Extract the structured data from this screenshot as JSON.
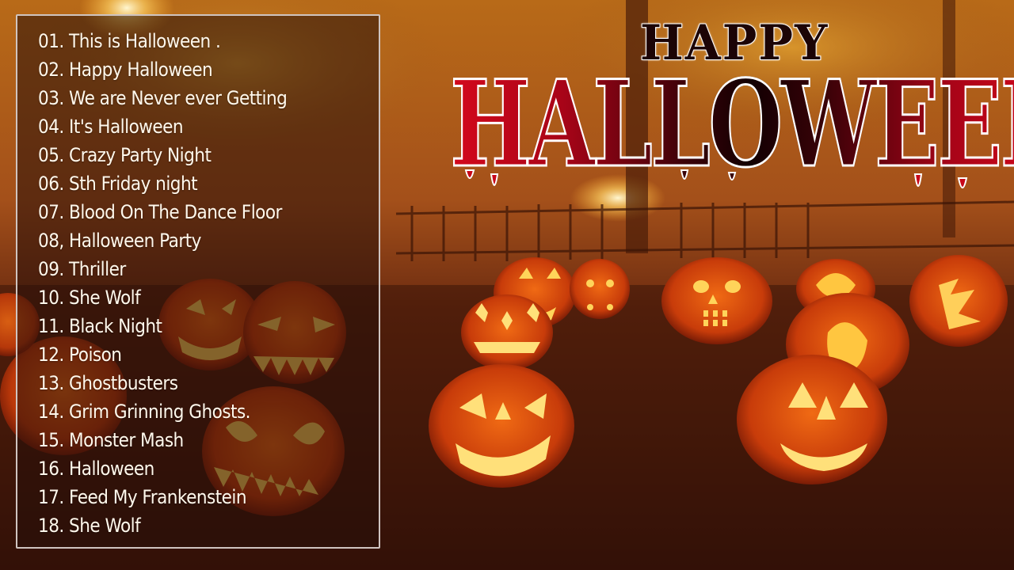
{
  "title": {
    "line1": "HAPPY",
    "line2": "HALLOWEEN"
  },
  "playlist": {
    "tracks": [
      "01. This is Halloween .",
      "02. Happy Halloween",
      "03. We are Never ever Getting",
      "04. It's Halloween",
      "05. Crazy Party Night",
      "06. Sth Friday night",
      "07. Blood On The Dance Floor",
      "08, Halloween Party",
      "09. Thriller",
      "10. She Wolf",
      "11. Black Night",
      "12. Poison",
      "13. Ghostbusters",
      "14. Grim Grinning Ghosts.",
      "15. Monster Mash",
      "16. Halloween",
      "17. Feed My Frankenstein",
      "18. She Wolf"
    ]
  },
  "colors": {
    "title_red": "#d4081c",
    "title_dark": "#120002",
    "panel_border": "#cfc4c0",
    "text": "#fff8ec",
    "pumpkin_glow": "#ffcc33",
    "pumpkin_body": "#d2420a"
  }
}
